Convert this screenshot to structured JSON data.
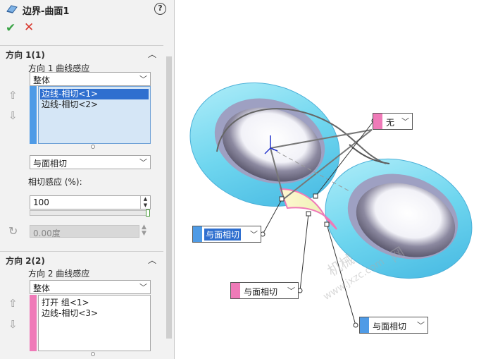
{
  "panel": {
    "title": "边界-曲面1",
    "help_glyph": "?",
    "ok_glyph": "✔",
    "cancel_glyph": "✕",
    "direction1": {
      "header": "方向 1(1)",
      "curve_label": "方向 1 曲线感应",
      "curve_value": "整体",
      "items": [
        "边线-相切<1>",
        "边线-相切<2>"
      ],
      "selected_index": 0,
      "stripe_color": "#4f9be6",
      "tangent_type": "与面相切",
      "tangent_influence_label": "相切感应 (%):",
      "tangent_influence_value": "100",
      "angle_value": "0.00度"
    },
    "direction2": {
      "header": "方向 2(2)",
      "curve_label": "方向 2 曲线感应",
      "curve_value": "整体",
      "items": [
        "打开 组<1>",
        "边线-相切<3>"
      ],
      "stripe_color": "#ef7ab8"
    }
  },
  "viewport": {
    "callouts": [
      {
        "text": "无",
        "swatch": "#ef7ab8",
        "selected": false
      },
      {
        "text": "与面相切",
        "swatch": "#4f9be6",
        "selected": true
      },
      {
        "text": "与面相切",
        "swatch": "#ef7ab8",
        "selected": false
      },
      {
        "text": "与面相切",
        "swatch": "#4f9be6",
        "selected": false
      }
    ],
    "watermark": [
      "机械",
      "网",
      "www.jxzc.com"
    ]
  }
}
